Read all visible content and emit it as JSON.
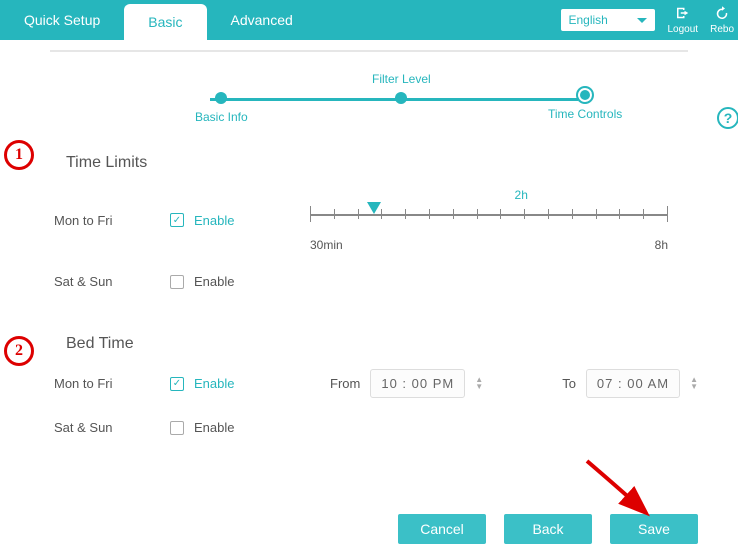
{
  "topbar": {
    "tabs": {
      "quick_setup": "Quick Setup",
      "basic": "Basic",
      "advanced": "Advanced"
    },
    "language": "English",
    "logout": "Logout",
    "reboot": "Rebo"
  },
  "stepper": {
    "s1": "Basic Info",
    "s2": "Filter Level",
    "s3": "Time Controls"
  },
  "time_limits": {
    "title": "Time Limits",
    "weekday_label": "Mon to Fri",
    "weekend_label": "Sat & Sun",
    "enable_label": "Enable",
    "weekday_enabled": true,
    "weekend_enabled": false,
    "slider": {
      "min_label": "30min",
      "max_label": "8h",
      "value_label": "2h",
      "value_pct": 18
    }
  },
  "bed_time": {
    "title": "Bed Time",
    "weekday_label": "Mon to Fri",
    "weekend_label": "Sat & Sun",
    "enable_label": "Enable",
    "weekday_enabled": true,
    "weekend_enabled": false,
    "from_label": "From",
    "to_label": "To",
    "from_value": "10 : 00  PM",
    "to_value": "07 : 00  AM"
  },
  "buttons": {
    "cancel": "Cancel",
    "back": "Back",
    "save": "Save"
  },
  "annotation": {
    "n1": "1",
    "n2": "2"
  }
}
